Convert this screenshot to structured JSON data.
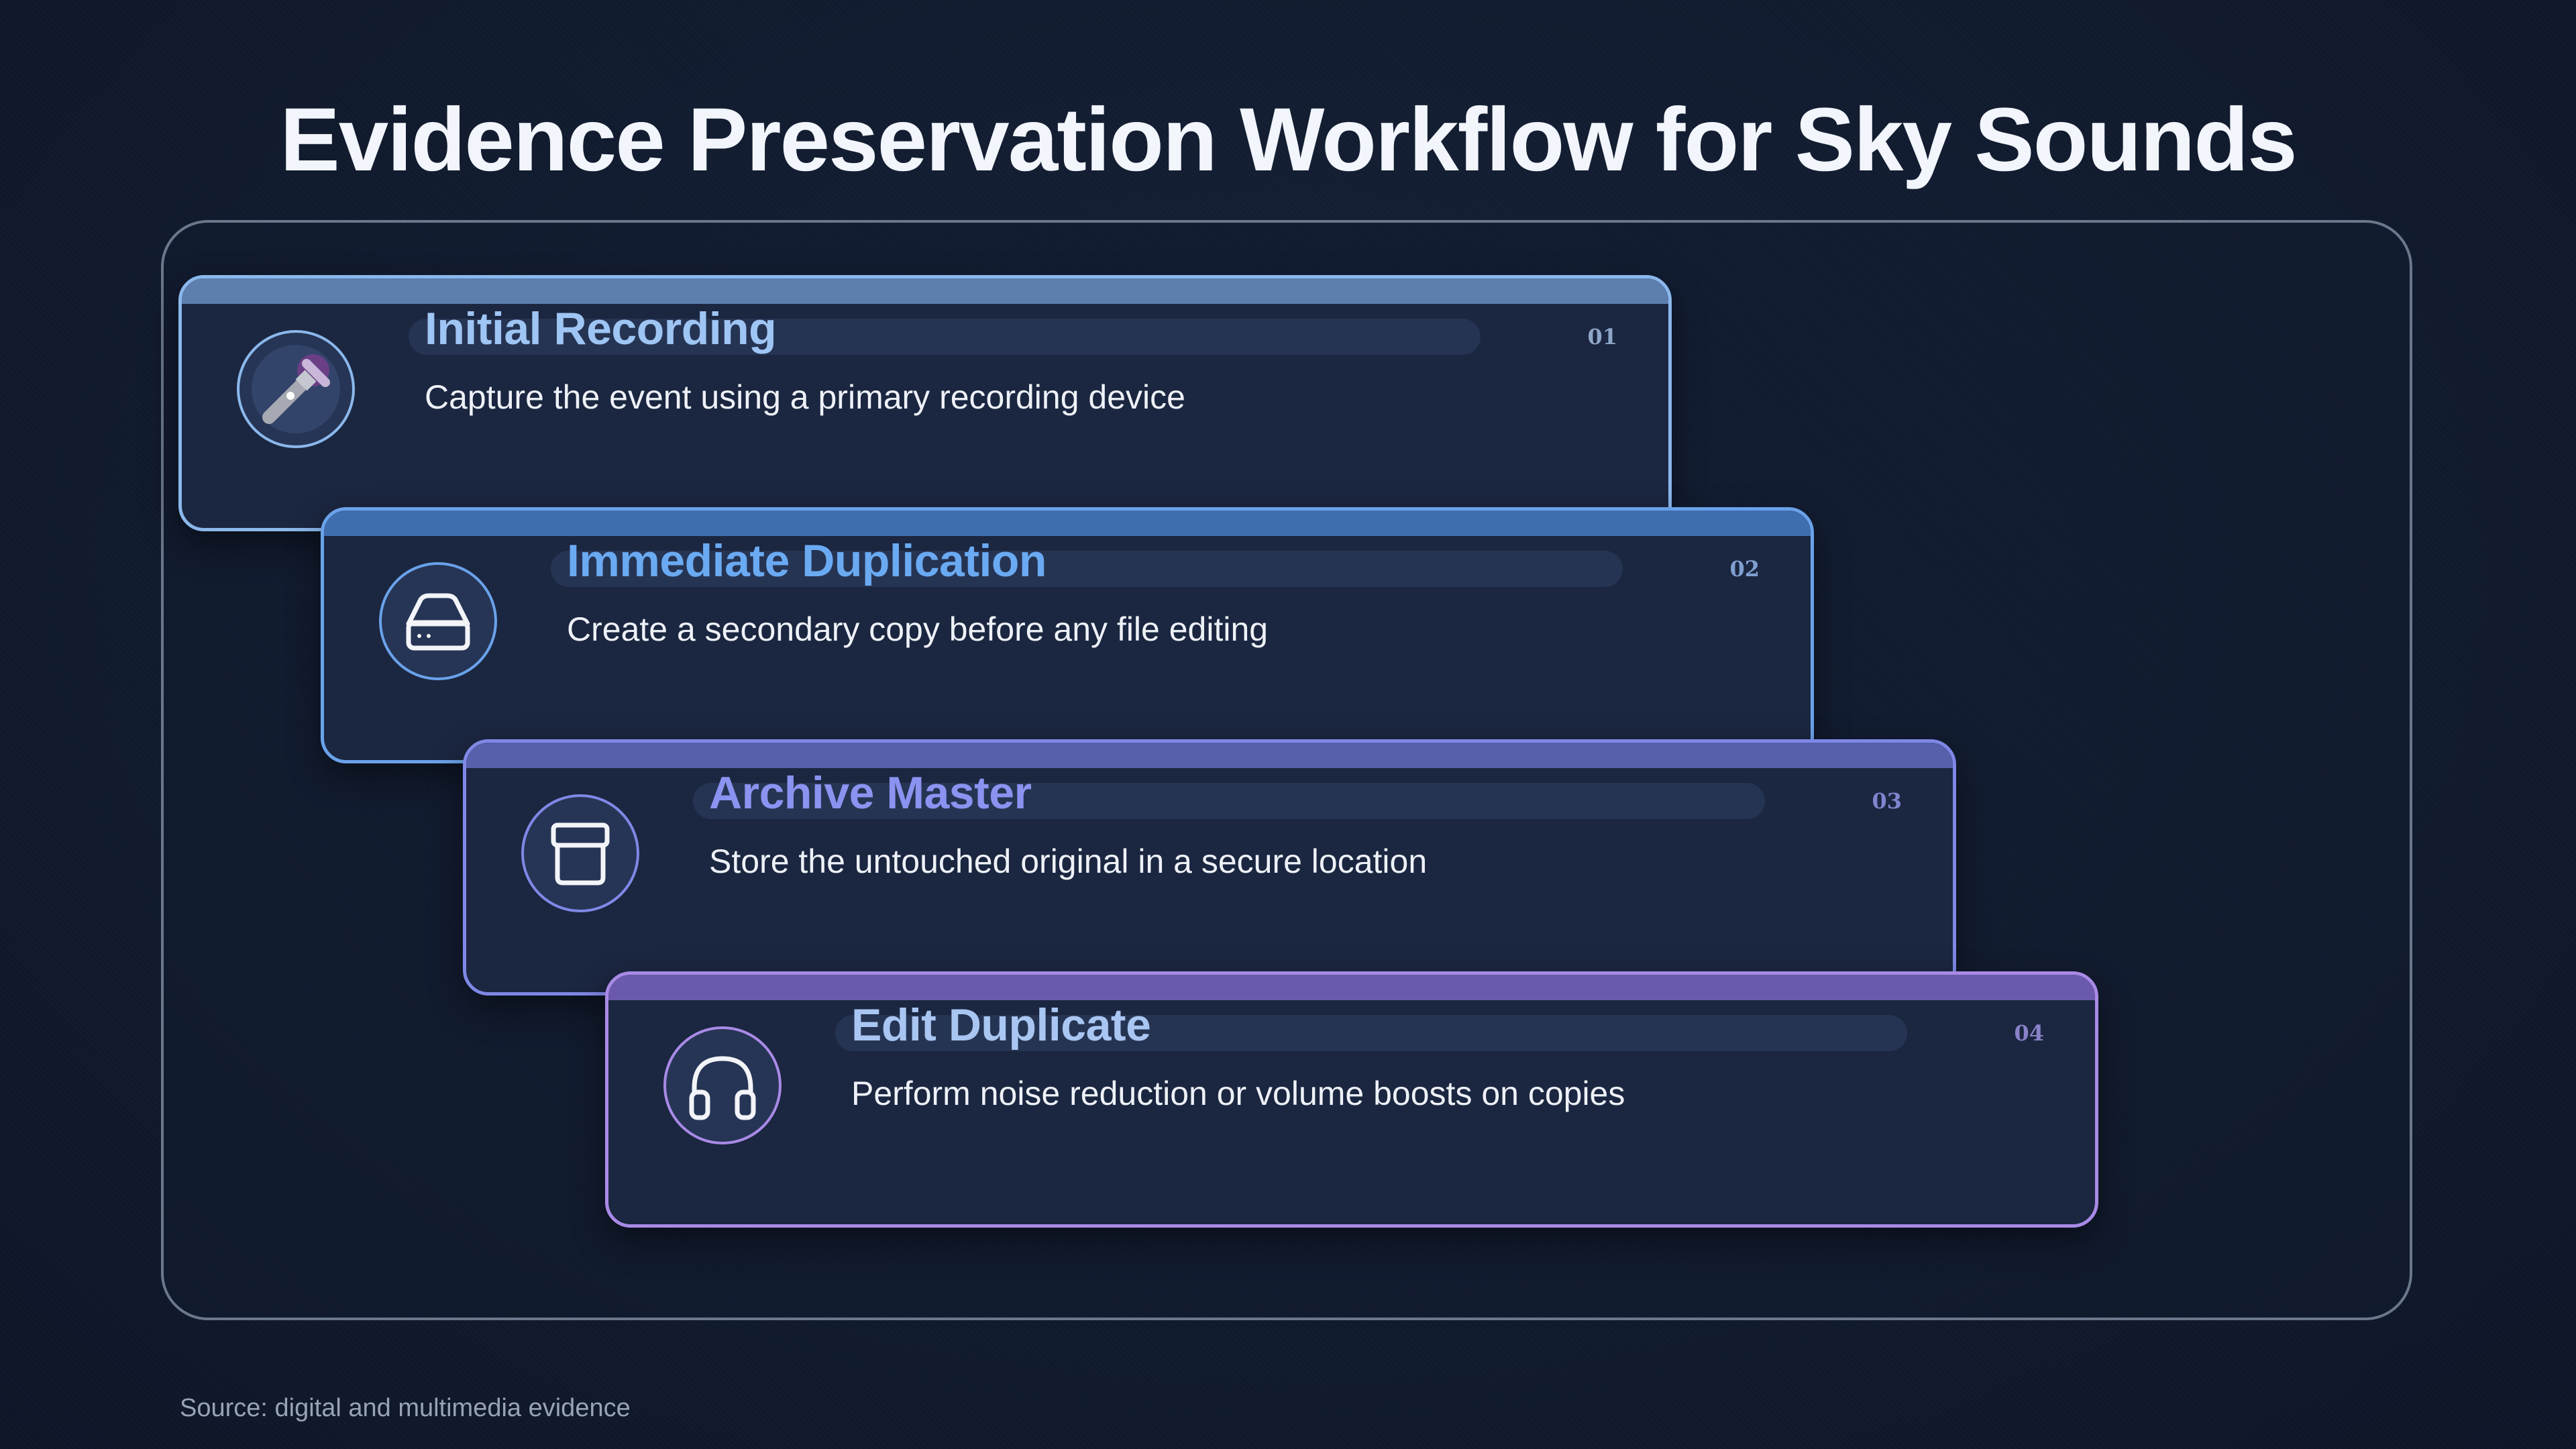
{
  "title": "Evidence Preservation Workflow for Sky Sounds",
  "steps": [
    {
      "number": "01",
      "title": "Initial Recording",
      "description": "Capture the event using a primary recording device",
      "icon": "microphone-icon",
      "title_color": "#9ec5f4",
      "border_color": "#8bb8ec",
      "bar_color": "#5c7fae",
      "number_color": "#8ea6c8"
    },
    {
      "number": "02",
      "title": "Immediate Duplication",
      "description": "Create a secondary copy before any file editing",
      "icon": "drive-icon",
      "title_color": "#6aaaf2",
      "border_color": "#6aa2ea",
      "bar_color": "#3f6eaf",
      "number_color": "#7f9fd0"
    },
    {
      "number": "03",
      "title": "Archive Master",
      "description": "Store the untouched original in a secure location",
      "icon": "archive-box-icon",
      "title_color": "#8a93f0",
      "border_color": "#7f88e6",
      "bar_color": "#5660ab",
      "number_color": "#7e86d0"
    },
    {
      "number": "04",
      "title": "Edit Duplicate",
      "description": "Perform noise reduction or volume boosts on copies",
      "icon": "headphones-icon",
      "title_color": "#a9c6f2",
      "border_color": "#a98ae6",
      "bar_color": "#6b5aac",
      "number_color": "#8a82c8"
    }
  ],
  "source": "Source: digital and multimedia evidence"
}
